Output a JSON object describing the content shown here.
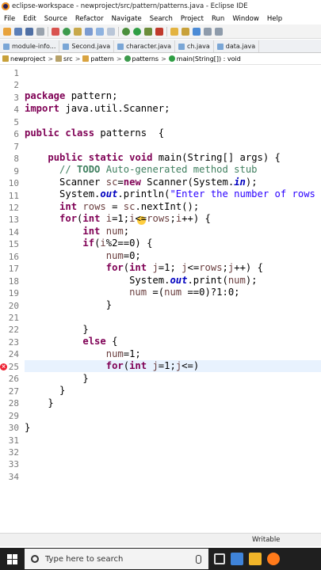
{
  "window": {
    "title": "eclipse-workspace - newproject/src/pattern/patterns.java - Eclipse IDE"
  },
  "menu": [
    "File",
    "Edit",
    "Source",
    "Refactor",
    "Navigate",
    "Search",
    "Project",
    "Run",
    "Window",
    "Help"
  ],
  "tabs": [
    {
      "label": "module-info..."
    },
    {
      "label": "Second.java"
    },
    {
      "label": "character.java"
    },
    {
      "label": "ch.java"
    },
    {
      "label": "data.java"
    }
  ],
  "breadcrumb": [
    "newproject",
    "src",
    "pattern",
    "patterns",
    "main(String[]) : void"
  ],
  "editor": {
    "line_numbers": [
      "1",
      "2",
      "3",
      "4",
      "5",
      "6",
      "7",
      "8",
      "9",
      "10",
      "11",
      "12",
      "13",
      "14",
      "15",
      "16",
      "17",
      "18",
      "19",
      "20",
      "21",
      "22",
      "23",
      "24",
      "25",
      "26",
      "27",
      "28",
      "29",
      "30",
      "31",
      "32",
      "33",
      "34"
    ]
  },
  "status": {
    "writable": "Writable"
  },
  "taskbar": {
    "search_placeholder": "Type here to search"
  },
  "colors": {
    "keyword": "#7f0055",
    "comment": "#3f7f5f",
    "string": "#2a00ff",
    "field": "#0000c0",
    "current_line": "#e8f2fe",
    "taskbar": "#1f1f1f"
  }
}
